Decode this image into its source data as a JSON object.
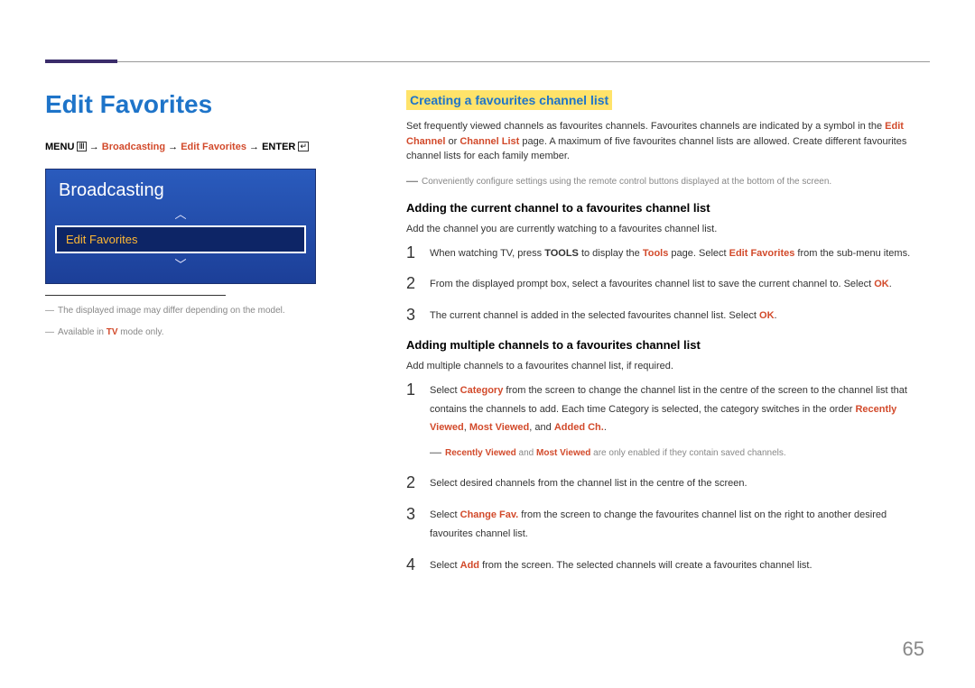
{
  "page_title": "Edit Favorites",
  "breadcrumb": {
    "menu": "MENU",
    "menu_icon": "Ⅲ",
    "arrow": "→",
    "broadcasting": "Broadcasting",
    "edit_favorites": "Edit Favorites",
    "enter": "ENTER",
    "enter_icon": "↵"
  },
  "osd": {
    "title": "Broadcasting",
    "up": "︿",
    "selected": "Edit Favorites",
    "down": "﹀"
  },
  "left_notes": {
    "n1_pre": "The displayed image may differ depending on the model.",
    "n2_pre": "Available in ",
    "n2_hl": "TV",
    "n2_post": " mode only."
  },
  "section_heading": "Creating a favourites channel list",
  "intro": {
    "t1": "Set frequently viewed channels as favourites channels. Favourites channels are indicated by a symbol in the ",
    "t1_hl1": "Edit Channel",
    "t1_mid": " or ",
    "t1_hl2": "Channel List",
    "t1_post": " page. A maximum of five favourites channel lists are allowed. Create different favourites channel lists for each family member."
  },
  "intro_note": "Conveniently configure settings using the remote control buttons displayed at the bottom of the screen.",
  "sub1": {
    "heading": "Adding the current channel to a favourites channel list",
    "lead": "Add the channel you are currently watching to a favourites channel list.",
    "steps": [
      {
        "n": "1",
        "pre": "When watching TV, press ",
        "s1": "TOOLS",
        "mid1": " to display the ",
        "hl1": "Tools",
        "mid2": " page. Select ",
        "hl2": "Edit Favorites",
        "post": " from the sub-menu items."
      },
      {
        "n": "2",
        "pre": "From the displayed prompt box, select a favourites channel list to save the current channel to. Select ",
        "hl1": "OK",
        "post": "."
      },
      {
        "n": "3",
        "pre": "The current channel is added in the selected favourites channel list. Select ",
        "hl1": "OK",
        "post": "."
      }
    ]
  },
  "sub2": {
    "heading": "Adding multiple channels to a favourites channel list",
    "lead": "Add multiple channels to a favourites channel list, if required.",
    "steps": [
      {
        "n": "1",
        "pre": "Select ",
        "hl1": "Category",
        "mid1": " from the screen to change the channel list in the centre of the screen to the channel list that contains the channels to add. Each time Category is selected, the category switches in the order ",
        "hl2": "Recently Viewed",
        "mid2": ", ",
        "hl3": "Most Viewed",
        "mid3": ", and ",
        "hl4": "Added Ch.",
        "post": ".",
        "note_hl1": "Recently Viewed",
        "note_mid": " and ",
        "note_hl2": "Most Viewed",
        "note_post": " are only enabled if they contain saved channels."
      },
      {
        "n": "2",
        "pre": "Select desired channels from the channel list in the centre of the screen.",
        "post": ""
      },
      {
        "n": "3",
        "pre": "Select ",
        "hl1": "Change Fav.",
        "post": " from the screen to change the favourites channel list on the right to another desired favourites channel list."
      },
      {
        "n": "4",
        "pre": "Select ",
        "hl1": "Add",
        "post": " from the screen. The selected channels will create a favourites channel list."
      }
    ]
  },
  "page_number": "65",
  "dash": "―"
}
